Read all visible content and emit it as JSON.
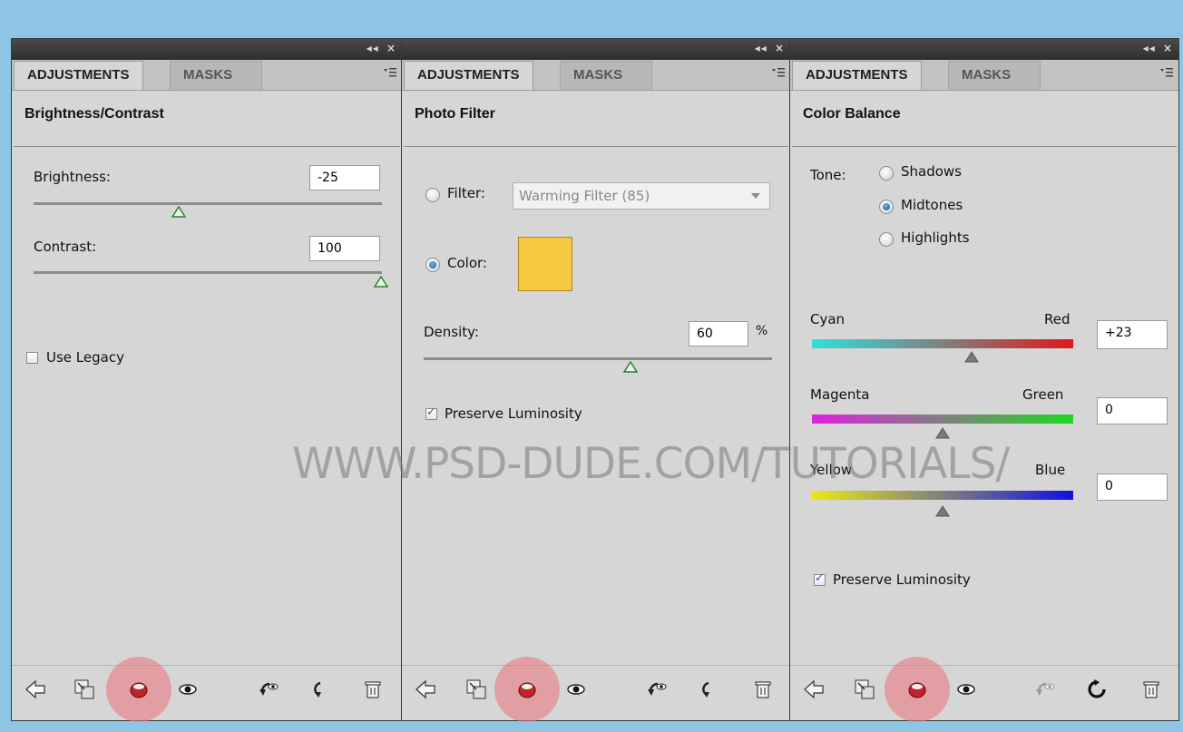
{
  "panels": [
    {
      "tabs": {
        "adjustments": "ADJUSTMENTS",
        "masks": "MASKS"
      },
      "title": "Brightness/Contrast",
      "brightness": {
        "label": "Brightness:",
        "value": "-25",
        "slider": 0.43
      },
      "contrast": {
        "label": "Contrast:",
        "value": "100",
        "slider": 1.0
      },
      "legacy": {
        "label": "Use Legacy",
        "checked": false
      }
    },
    {
      "tabs": {
        "adjustments": "ADJUSTMENTS",
        "masks": "MASKS"
      },
      "title": "Photo Filter",
      "filter": {
        "label": "Filter:",
        "value": "Warming Filter (85)",
        "selected": false
      },
      "color": {
        "label": "Color:",
        "selected": true,
        "swatch": "#f5c842"
      },
      "density": {
        "label": "Density:",
        "value": "60",
        "unit": "%",
        "slider": 0.6
      },
      "preserve": {
        "label": "Preserve Luminosity",
        "checked": true
      }
    },
    {
      "tabs": {
        "adjustments": "ADJUSTMENTS",
        "masks": "MASKS"
      },
      "title": "Color Balance",
      "tone": {
        "label": "Tone:",
        "options": [
          "Shadows",
          "Midtones",
          "Highlights"
        ],
        "selected": "Midtones"
      },
      "sliders": [
        {
          "left": "Cyan",
          "right": "Red",
          "value": "+23",
          "gradient": [
            "#2ee0dc",
            "#e01818"
          ]
        },
        {
          "left": "Magenta",
          "right": "Green",
          "value": "0",
          "gradient": [
            "#e020e0",
            "#20d820"
          ]
        },
        {
          "left": "Yellow",
          "right": "Blue",
          "value": "0",
          "gradient": [
            "#e8e818",
            "#1010e0"
          ]
        }
      ],
      "preserve": {
        "label": "Preserve Luminosity",
        "checked": true
      }
    }
  ],
  "window_controls": {
    "collapse": "◂◂",
    "close": "×"
  },
  "toolbar_icons": [
    "back-arrow-icon",
    "clip-to-layer-icon",
    "visibility-highlight-icon",
    "eye-icon",
    "view-previous-icon",
    "reset-icon",
    "trash-icon"
  ],
  "watermark": "WWW.PSD-DUDE.COM/TUTORIALS/"
}
